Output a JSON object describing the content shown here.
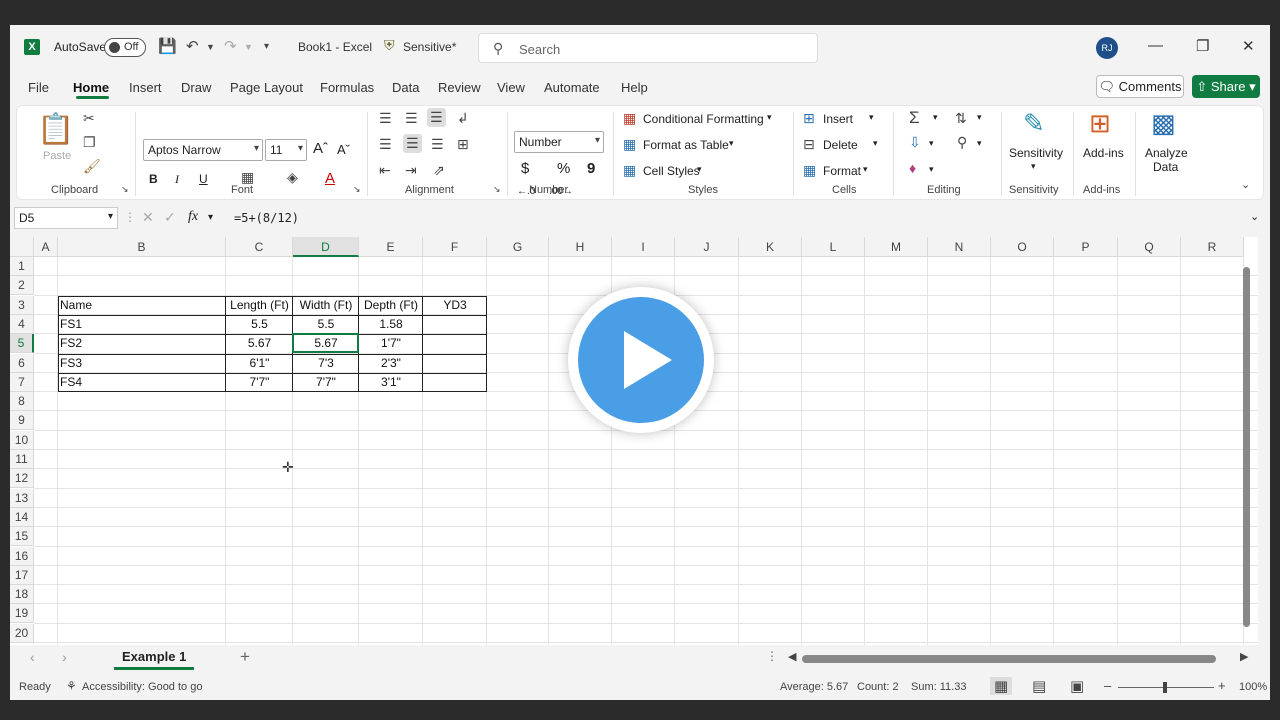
{
  "titlebar": {
    "app_logo": "X",
    "autosave_label": "AutoSave",
    "autosave_state": "Off",
    "document_title": "Book1  -  Excel",
    "sensitivity_label": "Sensitive*",
    "search_placeholder": "Search",
    "user_initials": "RJ"
  },
  "menu": {
    "items": [
      "File",
      "Home",
      "Insert",
      "Draw",
      "Page Layout",
      "Formulas",
      "Data",
      "Review",
      "View",
      "Automate",
      "Help"
    ],
    "active": "Home",
    "comments_label": "Comments",
    "share_label": "Share"
  },
  "ribbon": {
    "clipboard": {
      "label": "Clipboard",
      "paste_label": "Paste"
    },
    "font": {
      "label": "Font",
      "font_name": "Aptos Narrow",
      "font_size": "11",
      "bold": "B",
      "italic": "I",
      "underline": "U"
    },
    "alignment": {
      "label": "Alignment"
    },
    "number": {
      "label": "Number",
      "format": "Number"
    },
    "styles": {
      "label": "Styles",
      "conditional_formatting": "Conditional Formatting",
      "format_as_table": "Format as Table",
      "cell_styles": "Cell Styles"
    },
    "cells": {
      "label": "Cells",
      "insert": "Insert",
      "delete": "Delete",
      "format": "Format"
    },
    "editing": {
      "label": "Editing"
    },
    "sensitivity": {
      "label": "Sensitivity",
      "button": "Sensitivity"
    },
    "addins": {
      "label": "Add-ins",
      "button": "Add-ins"
    },
    "analyze": {
      "button_line1": "Analyze",
      "button_line2": "Data"
    }
  },
  "formula_bar": {
    "name_box": "D5",
    "fx": "fx",
    "formula": "=5+(8/12)"
  },
  "grid": {
    "columns": [
      "A",
      "B",
      "C",
      "D",
      "E",
      "F",
      "G",
      "H",
      "I",
      "J",
      "K",
      "L",
      "M",
      "N",
      "O",
      "P",
      "Q",
      "R"
    ],
    "rows": [
      "1",
      "2",
      "3",
      "4",
      "5",
      "6",
      "7",
      "8",
      "9",
      "10",
      "11",
      "12",
      "13",
      "14",
      "15",
      "16",
      "17",
      "18",
      "19",
      "20"
    ],
    "selected_column": "D",
    "selected_row": "5",
    "table": {
      "headers": [
        "Name",
        "Length (Ft)",
        "Width (Ft)",
        "Depth (Ft)",
        "YD3"
      ],
      "rows": [
        [
          "FS1",
          "5.5",
          "5.5",
          "1.58",
          ""
        ],
        [
          "FS2",
          "5.67",
          "5.67",
          "1'7\"",
          ""
        ],
        [
          "FS3",
          "6'1\"",
          "7'3",
          "2'3\"",
          ""
        ],
        [
          "FS4",
          "7'7\"",
          "7'7\"",
          "3'1\"",
          ""
        ]
      ]
    }
  },
  "sheets": {
    "active": "Example 1"
  },
  "status_bar": {
    "ready": "Ready",
    "accessibility": "Accessibility: Good to go",
    "average": "Average: 5.67",
    "count": "Count: 2",
    "sum": "Sum: 11.33",
    "zoom": "100%"
  },
  "colors": {
    "excel_green": "#107c41",
    "play_blue": "#4a9ee6"
  }
}
